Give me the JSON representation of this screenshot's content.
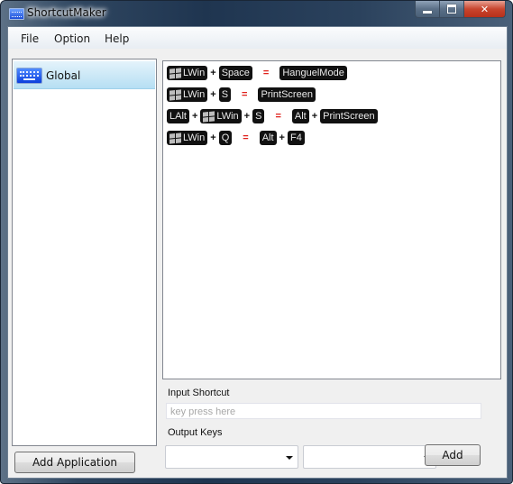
{
  "window": {
    "title": "ShortcutMaker",
    "icon": "keyboard-icon",
    "controls": {
      "minimize": "minimize-icon",
      "maximize": "maximize-icon",
      "close": "close-icon"
    }
  },
  "menubar": {
    "items": [
      {
        "label": "File"
      },
      {
        "label": "Option"
      },
      {
        "label": "Help"
      }
    ]
  },
  "sidebar": {
    "items": [
      {
        "label": "Global",
        "icon": "keyboard-icon",
        "selected": true
      }
    ],
    "add_button_label": "Add Application"
  },
  "shortcuts": [
    {
      "input": [
        {
          "key": "LWin",
          "win_icon": true
        },
        {
          "key": "Space"
        }
      ],
      "output": [
        {
          "key": "HanguelMode"
        }
      ]
    },
    {
      "input": [
        {
          "key": "LWin",
          "win_icon": true
        },
        {
          "key": "S"
        }
      ],
      "output": [
        {
          "key": "PrintScreen"
        }
      ]
    },
    {
      "input": [
        {
          "key": "LAlt"
        },
        {
          "key": "LWin",
          "win_icon": true
        },
        {
          "key": "S"
        }
      ],
      "output": [
        {
          "key": "Alt"
        },
        {
          "key": "PrintScreen"
        }
      ]
    },
    {
      "input": [
        {
          "key": "LWin",
          "win_icon": true
        },
        {
          "key": "Q"
        }
      ],
      "output": [
        {
          "key": "Alt"
        },
        {
          "key": "F4"
        }
      ]
    }
  ],
  "symbols": {
    "plus": "+",
    "equals": "="
  },
  "colors": {
    "equals": "#e0201b",
    "key_bg": "#111111",
    "selection": "#b6dff3"
  },
  "form": {
    "input_label": "Input Shortcut",
    "input_placeholder": "key press here",
    "input_value": "",
    "output_label": "Output Keys",
    "output_combo_1": "",
    "output_combo_2": "",
    "add_button_label": "Add"
  }
}
